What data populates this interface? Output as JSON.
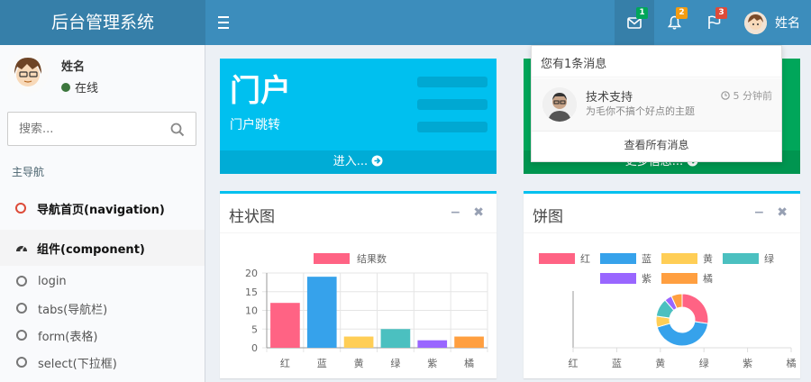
{
  "app": {
    "title": "后台管理系统"
  },
  "header": {
    "messages_badge": "1",
    "notifications_badge": "2",
    "tasks_badge": "3",
    "user_name": "姓名",
    "colors": {
      "green": "#00a65a",
      "yellow": "#f39c12",
      "red": "#dd4b39"
    }
  },
  "sidebar": {
    "user": {
      "name": "姓名",
      "status": "在线"
    },
    "search_placeholder": "搜索...",
    "nav_header": "主导航",
    "items": [
      {
        "label": "导航首页(navigation)"
      },
      {
        "label": "组件(component)"
      },
      {
        "label": "login"
      },
      {
        "label": "tabs(导航栏)"
      },
      {
        "label": "form(表格)"
      },
      {
        "label": "select(下拉框)"
      }
    ]
  },
  "cards": {
    "portal": {
      "title": "门户",
      "subtitle": "门户跳转",
      "footer": "进入..."
    },
    "green": {
      "footer": "更多信息..."
    }
  },
  "dropdown": {
    "header": "您有1条消息",
    "message": {
      "from": "技术支持",
      "time": "5 分钟前",
      "body": "为毛你不搞个好点的主题"
    },
    "footer": "查看所有消息"
  },
  "bar_box": {
    "title": "柱状图",
    "minimize": "−",
    "close": "✖"
  },
  "pie_box": {
    "title": "饼图",
    "minimize": "−",
    "close": "✖"
  },
  "chart_data": [
    {
      "type": "bar",
      "categories": [
        "红",
        "蓝",
        "黄",
        "绿",
        "紫",
        "橘"
      ],
      "series": [
        {
          "name": "结果数",
          "values": [
            12,
            19,
            3,
            5,
            2,
            3
          ]
        }
      ],
      "colors": [
        "#ff6384",
        "#36a2eb",
        "#ffce56",
        "#4bc0c0",
        "#9966ff",
        "#ff9f40"
      ],
      "ylim": [
        0,
        20
      ],
      "yticks": [
        0,
        5,
        10,
        15,
        20
      ],
      "grid": true,
      "legend": "top"
    },
    {
      "type": "pie",
      "categories": [
        "红",
        "蓝",
        "黄",
        "绿",
        "紫",
        "橘"
      ],
      "values": [
        12,
        19,
        3,
        5,
        2,
        3
      ],
      "colors": [
        "#ff6384",
        "#36a2eb",
        "#ffce56",
        "#4bc0c0",
        "#9966ff",
        "#ff9f40"
      ],
      "legend": "top"
    }
  ]
}
